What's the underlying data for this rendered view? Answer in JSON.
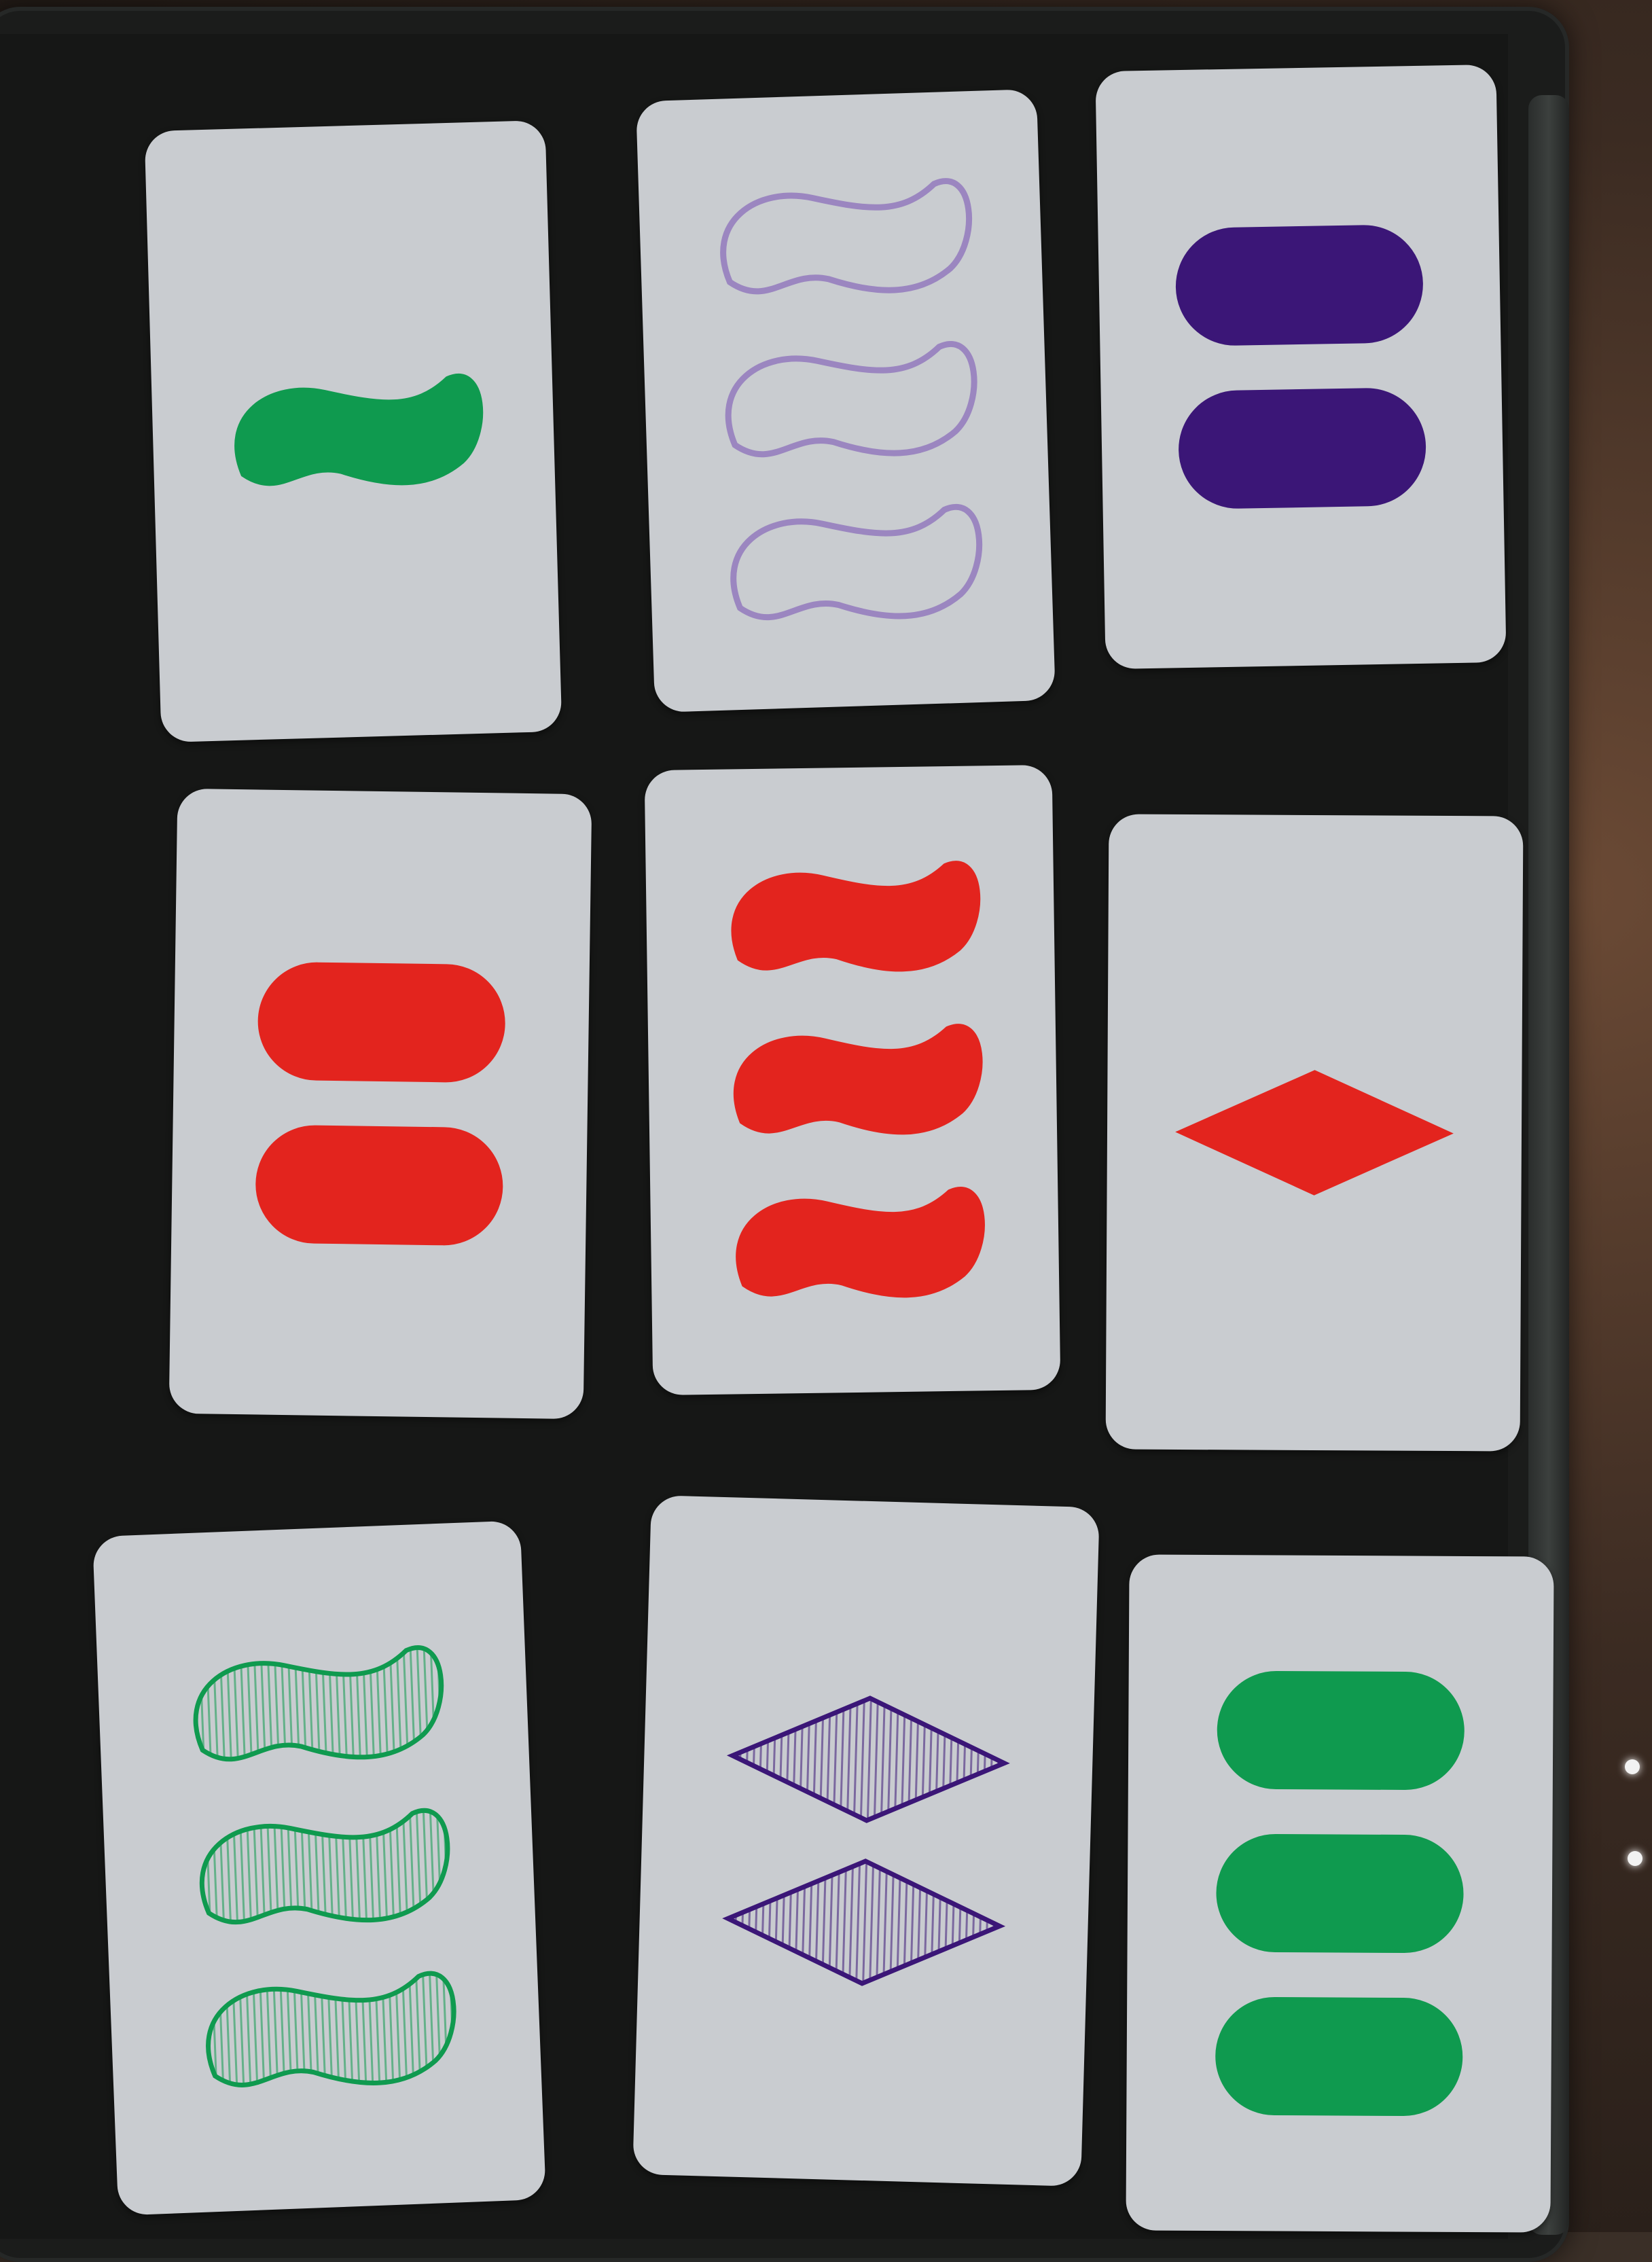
{
  "game": {
    "title": "",
    "colors": {
      "green": "#0f9a4f",
      "purple": "#3b1677",
      "lavender": "#9b86c0",
      "red": "#e3241e",
      "card": "#c9ccd0"
    },
    "cards": [
      {
        "count": 1,
        "shape": "squiggle",
        "color": "green",
        "shading": "solid"
      },
      {
        "count": 3,
        "shape": "squiggle",
        "color": "purple",
        "shading": "open"
      },
      {
        "count": 2,
        "shape": "oval",
        "color": "purple",
        "shading": "solid"
      },
      {
        "count": 2,
        "shape": "oval",
        "color": "red",
        "shading": "solid"
      },
      {
        "count": 3,
        "shape": "squiggle",
        "color": "red",
        "shading": "solid"
      },
      {
        "count": 1,
        "shape": "diamond",
        "color": "red",
        "shading": "solid"
      },
      {
        "count": 3,
        "shape": "squiggle",
        "color": "green",
        "shading": "striped"
      },
      {
        "count": 2,
        "shape": "diamond",
        "color": "purple",
        "shading": "striped"
      },
      {
        "count": 3,
        "shape": "oval",
        "color": "green",
        "shading": "solid"
      }
    ]
  }
}
